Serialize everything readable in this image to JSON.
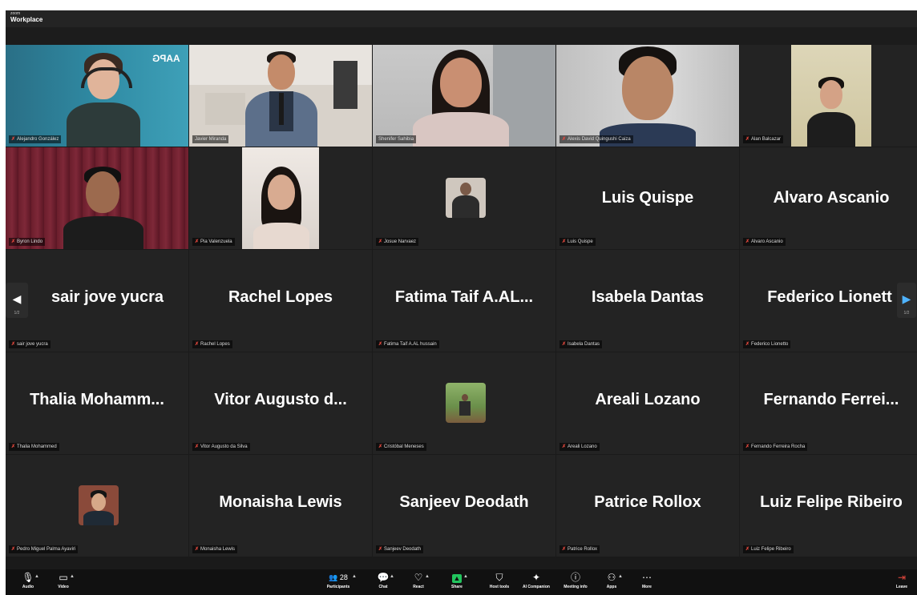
{
  "app": {
    "brand_small": "zoom",
    "brand_big": "Workplace"
  },
  "tiles": [
    {
      "label": "Alejandro González",
      "muted": true,
      "kind": "video"
    },
    {
      "label": "Javier Miranda",
      "muted": false,
      "kind": "video"
    },
    {
      "label": "Shenifer Sahibia",
      "muted": false,
      "kind": "video",
      "speaking": true
    },
    {
      "label": "Alexis David Quingushi Caiza",
      "muted": true,
      "kind": "video"
    },
    {
      "label": "Alan Balcazar",
      "muted": true,
      "kind": "video"
    },
    {
      "label": "Byron Lindo",
      "muted": true,
      "kind": "video"
    },
    {
      "label": "Pia Valenzuela",
      "muted": true,
      "kind": "video"
    },
    {
      "label": "Josue Narvaez",
      "muted": true,
      "kind": "avatar"
    },
    {
      "display": "Luis Quispe",
      "label": "Luis Quispe",
      "muted": true,
      "kind": "name"
    },
    {
      "display": "Alvaro Ascanio",
      "label": "Alvaro Ascanio",
      "muted": true,
      "kind": "name"
    },
    {
      "display": "sair jove yucra",
      "label": "sair jove yucra",
      "muted": true,
      "kind": "name"
    },
    {
      "display": "Rachel Lopes",
      "label": "Rachel Lopes",
      "muted": true,
      "kind": "name"
    },
    {
      "display": "Fatima Taif A.AL...",
      "label": "Fatima Taif A.AL hussain",
      "muted": true,
      "kind": "name"
    },
    {
      "display": "Isabela Dantas",
      "label": "Isabela Dantas",
      "muted": true,
      "kind": "name"
    },
    {
      "display": "Federico Lionett",
      "label": "Federico Lionetto",
      "muted": true,
      "kind": "name"
    },
    {
      "display": "Thalia Mohamm...",
      "label": "Thalia Mohammed",
      "muted": true,
      "kind": "name"
    },
    {
      "display": "Vitor Augusto d...",
      "label": "Vitor Augusto da Silva",
      "muted": true,
      "kind": "name"
    },
    {
      "label": "Cristóbal Meneses",
      "muted": true,
      "kind": "avatar"
    },
    {
      "display": "Areali Lozano",
      "label": "Areali Lozano",
      "muted": true,
      "kind": "name"
    },
    {
      "display": "Fernando Ferrei...",
      "label": "Fernando Ferreira Rocha",
      "muted": true,
      "kind": "name"
    },
    {
      "label": "Pedro Miguel Palma Ayaviri",
      "muted": true,
      "kind": "avatar"
    },
    {
      "display": "Monaisha Lewis",
      "label": "Monaisha Lewis",
      "muted": true,
      "kind": "name"
    },
    {
      "display": "Sanjeev Deodath",
      "label": "Sanjeev Deodath",
      "muted": true,
      "kind": "name"
    },
    {
      "display": "Patrice Rollox",
      "label": "Patrice Rollox",
      "muted": true,
      "kind": "name"
    },
    {
      "display": "Luiz Felipe Ribeiro",
      "label": "Luiz Felipe Ribeiro",
      "muted": true,
      "kind": "name"
    }
  ],
  "paging": {
    "prev_page": "1/2",
    "next_page": "1/2"
  },
  "toolbar": {
    "audio": "Audio",
    "video": "Video",
    "participants": "Participants",
    "participants_count": "28",
    "chat": "Chat",
    "react": "React",
    "share": "Share",
    "host_tools": "Host tools",
    "ai_companion": "AI Companion",
    "meeting_info": "Meeting info",
    "apps": "Apps",
    "more": "More",
    "leave": "Leave"
  },
  "colors": {
    "speaking_border": "#2ecc71",
    "muted_icon": "#e5483d",
    "share_green": "#22c55e"
  }
}
